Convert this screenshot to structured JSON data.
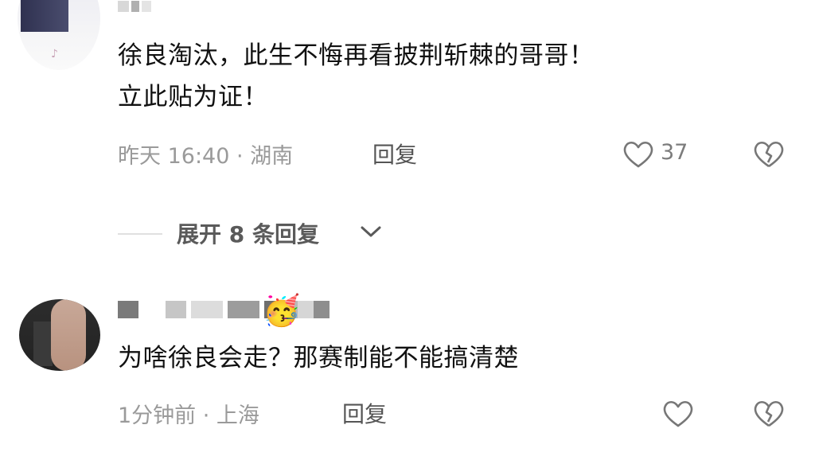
{
  "comments": [
    {
      "text_line1": "徐良淘汰，此生不悔再看披荆斩棘的哥哥！",
      "text_line2": "立此贴为证！",
      "meta": "昨天 16:40 · 湖南",
      "reply_label": "回复",
      "like_count": "37",
      "expand_label": "展开 8 条回复"
    },
    {
      "text": "为啥徐良会走？那赛制能不能搞清楚",
      "meta": "1分钟前 · 上海",
      "reply_label": "回复",
      "emoji": "🥳"
    }
  ]
}
